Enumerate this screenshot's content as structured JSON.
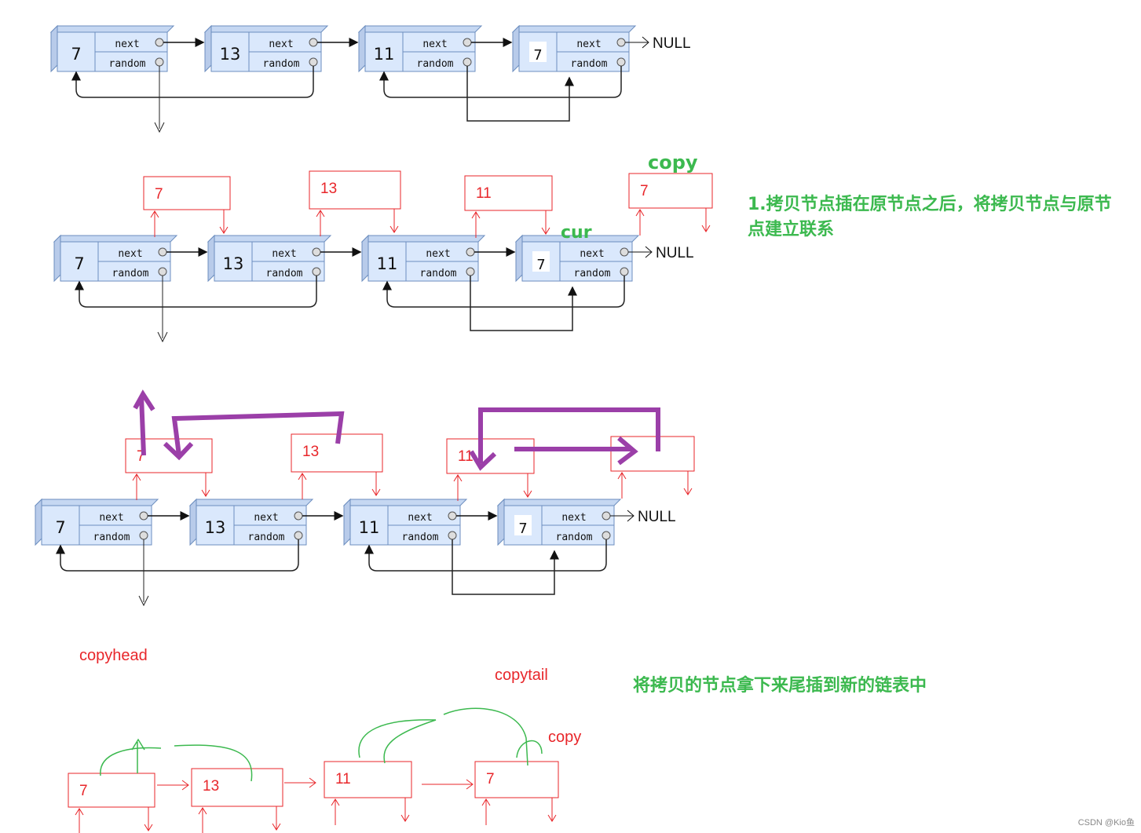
{
  "colors": {
    "node_fill": "#dae8fc",
    "node_stroke": "#6c8ebf",
    "copy_box": "#e8262a",
    "annotation": "#3cb94f",
    "hand_drawn": "#9b3fa8"
  },
  "field_labels": {
    "next": "next",
    "random": "random",
    "null": "NULL"
  },
  "rows": [
    {
      "nodes": [
        "7",
        "13",
        "11",
        "7"
      ],
      "copies": []
    },
    {
      "nodes": [
        "7",
        "13",
        "11",
        "7"
      ],
      "copies": [
        "7",
        "13",
        "11",
        "7"
      ]
    },
    {
      "nodes": [
        "7",
        "13",
        "11",
        "7"
      ],
      "copies": [
        "7",
        "13",
        "11",
        ""
      ]
    },
    {
      "nodes": [],
      "copies": [
        "7",
        "13",
        "11",
        "7"
      ]
    }
  ],
  "labels": {
    "copy": "copy",
    "cur": "cur",
    "step1": "1.拷贝节点插在原节点之后，将拷贝节点与原节点建立联系",
    "copyhead": "copyhead",
    "copytail": "copytail",
    "copy2": "copy",
    "step2": "将拷贝的节点拿下来尾插到新的链表中",
    "watermark": "CSDN @Kio鱼"
  }
}
